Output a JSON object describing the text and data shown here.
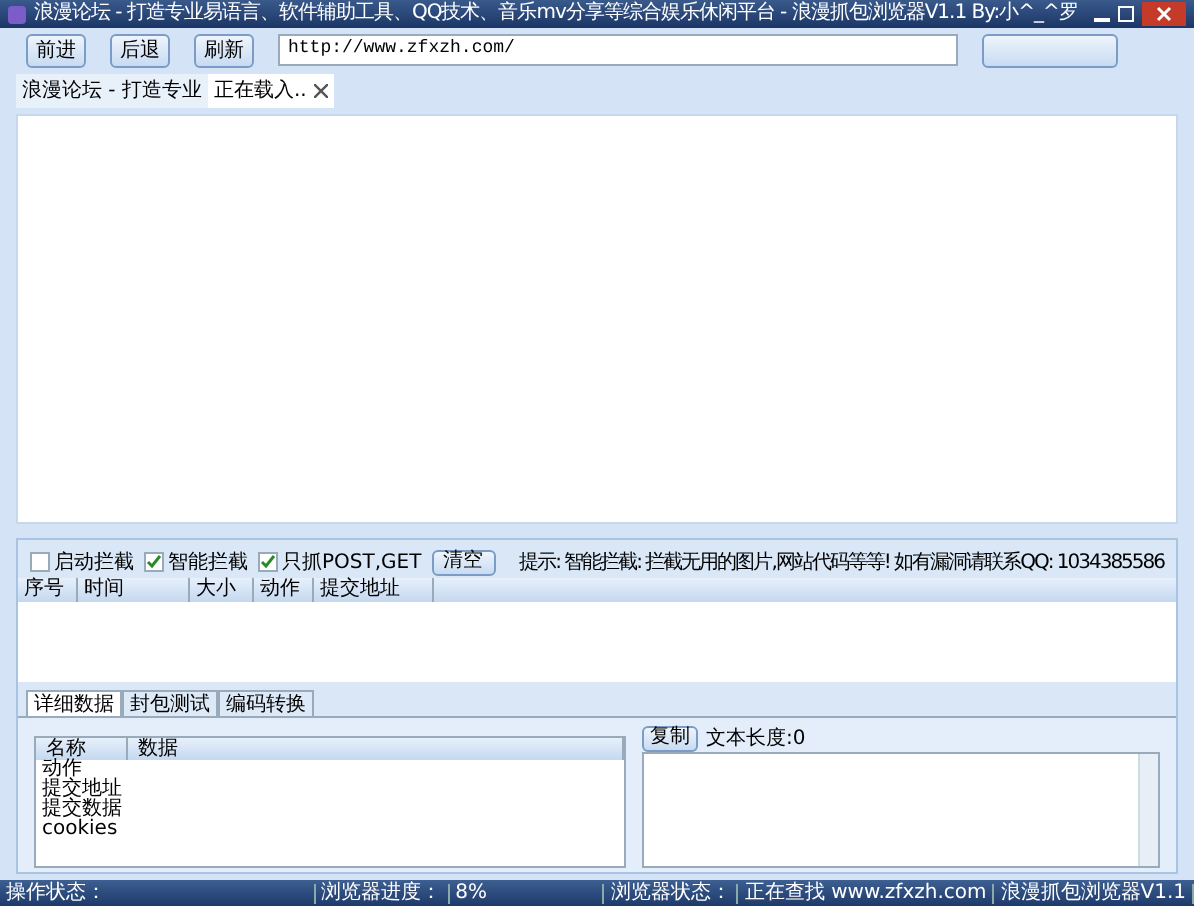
{
  "window": {
    "title": "浪漫论坛 - 打造专业易语言、软件辅助工具、QQ技术、音乐mv分享等综合娱乐休闲平台 - 浪漫抓包浏览器V1.1 By:小^_^罗"
  },
  "toolbar": {
    "buttons": [
      "前进",
      "后退",
      "刷新"
    ],
    "address": "http://www.zfxzh.com/"
  },
  "browser_tabs": [
    {
      "label": "浪漫论坛 - 打造专业",
      "selected": false,
      "closable": false
    },
    {
      "label": "正在载入..",
      "selected": true,
      "closable": true
    }
  ],
  "options": [
    {
      "label": "启动拦截",
      "checked": false
    },
    {
      "label": "智能拦截",
      "checked": true
    },
    {
      "label": "只抓POST,GET",
      "checked": true
    }
  ],
  "clear_button": "清空",
  "hint": "提示: 智能拦截: 拦截无用的图片,网站代码等等!  如有漏洞请联系QQ: 1034385586",
  "capture_table": {
    "columns": [
      "序号",
      "时间",
      "大小",
      "动作",
      "提交地址"
    ]
  },
  "detail_tabs": [
    {
      "label": "详细数据",
      "selected": true
    },
    {
      "label": "封包测试",
      "selected": false
    },
    {
      "label": "编码转换",
      "selected": false
    }
  ],
  "detail_table": {
    "columns": [
      "名称",
      "数据"
    ],
    "rows": [
      "动作",
      "提交地址",
      "提交数据",
      "cookies"
    ]
  },
  "copy_button": "复制",
  "text_length": "文本长度:0",
  "status_bar": [
    "操作状态：",
    "浏览器进度：",
    "8%",
    "浏览器状态：",
    "正在查找 www.zfxzh.com",
    "浪漫抓包浏览器V1.1"
  ]
}
